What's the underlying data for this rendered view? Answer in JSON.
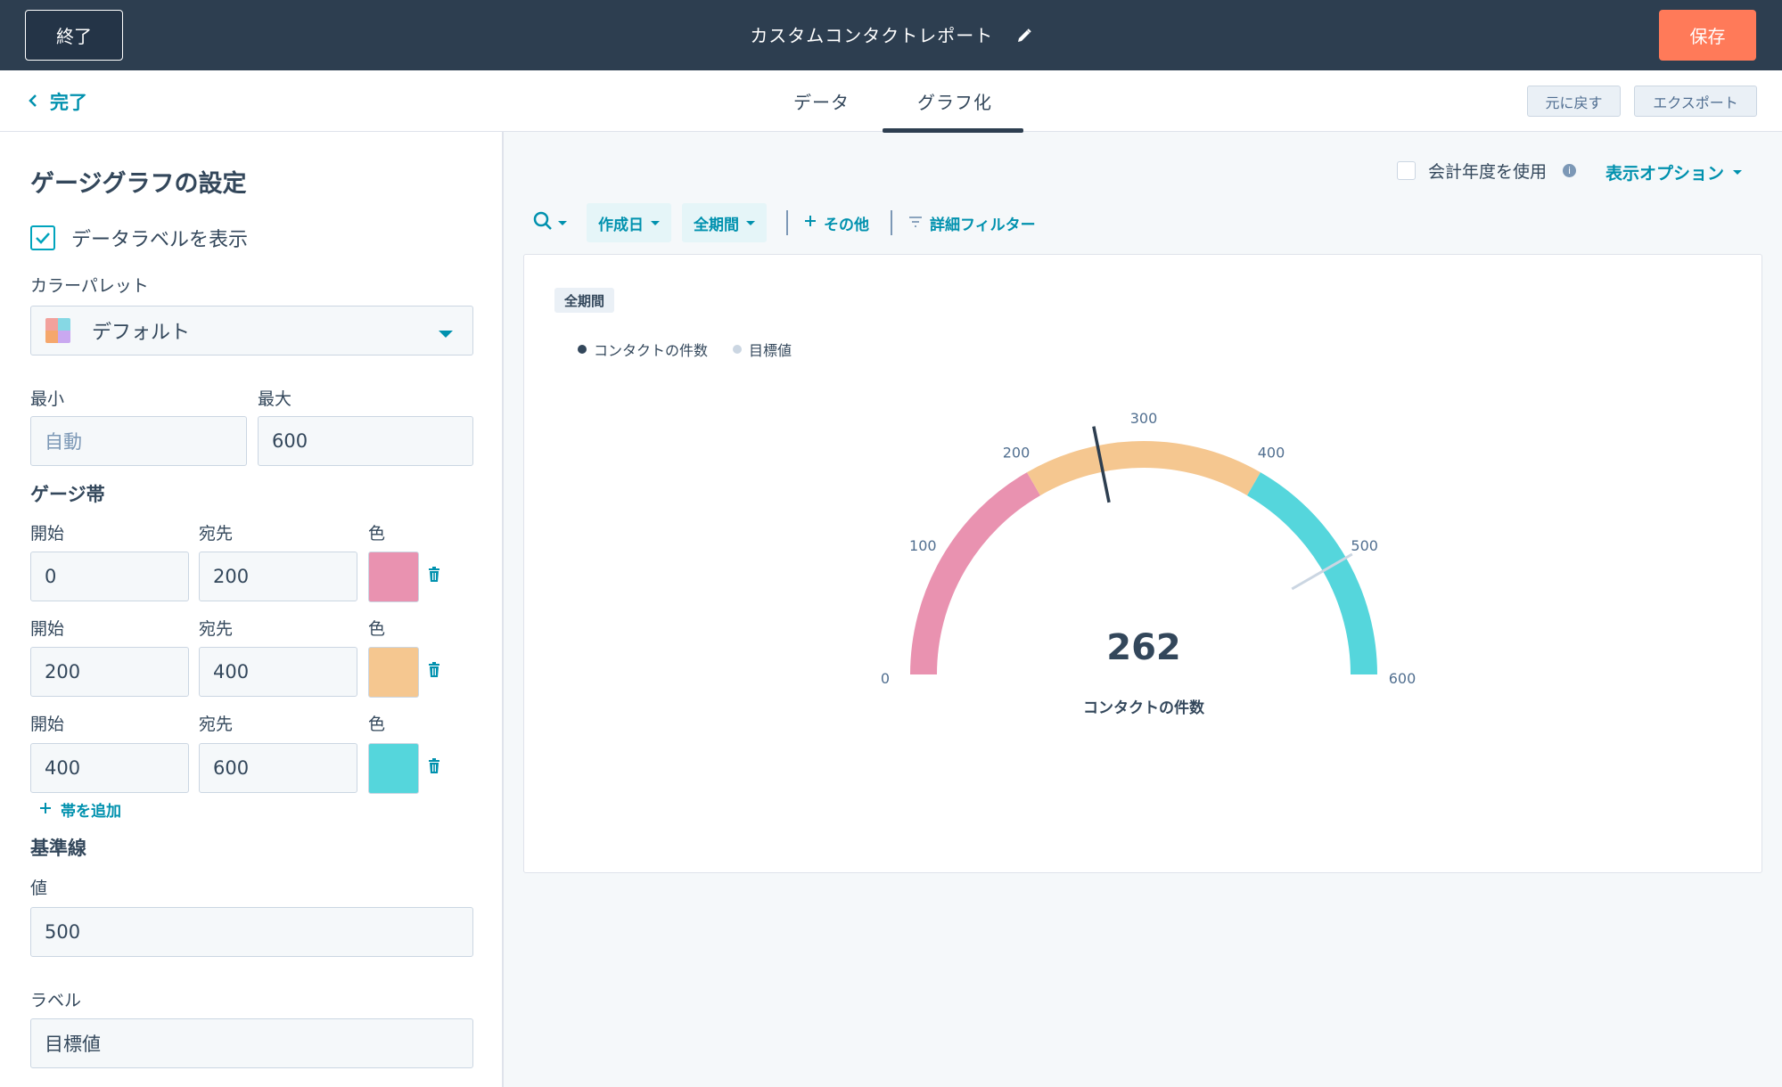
{
  "topbar": {
    "exit_label": "終了",
    "report_title": "カスタムコンタクトレポート",
    "save_label": "保存"
  },
  "subbar": {
    "back_label": "完了",
    "tabs": [
      {
        "label": "データ",
        "active": false
      },
      {
        "label": "グラフ化",
        "active": true
      }
    ],
    "undo_label": "元に戻す",
    "export_label": "エクスポート"
  },
  "settings": {
    "title": "ゲージグラフの設定",
    "show_data_labels": {
      "label": "データラベルを表示",
      "checked": true
    },
    "palette": {
      "label": "カラーパレット",
      "value": "デフォルト"
    },
    "min": {
      "label": "最小",
      "placeholder": "自動",
      "value": ""
    },
    "max": {
      "label": "最大",
      "value": "600"
    },
    "bands_heading": "ゲージ帯",
    "bands": [
      {
        "start_label": "開始",
        "end_label": "宛先",
        "color_label": "色",
        "start": "0",
        "end": "200",
        "color": "#e992b0"
      },
      {
        "start_label": "開始",
        "end_label": "宛先",
        "color_label": "色",
        "start": "200",
        "end": "400",
        "color": "#f5c790"
      },
      {
        "start_label": "開始",
        "end_label": "宛先",
        "color_label": "色",
        "start": "400",
        "end": "600",
        "color": "#55d6dc"
      }
    ],
    "add_band_label": "帯を追加",
    "baseline": {
      "heading": "基準線",
      "value_label": "値",
      "value": "500",
      "label_label": "ラベル",
      "label_value": "目標値"
    }
  },
  "toolbar": {
    "fiscal_year_label": "会計年度を使用",
    "fiscal_year_checked": false,
    "display_options_label": "表示オプション",
    "filters": [
      {
        "label": "作成日"
      },
      {
        "label": "全期間"
      }
    ],
    "more_label": "その他",
    "advanced_filter_label": "詳細フィルター"
  },
  "chart_data": {
    "type": "gauge",
    "period_tag": "全期間",
    "legend": [
      {
        "name": "コンタクトの件数",
        "color": "#33475b"
      },
      {
        "name": "目標値",
        "color": "#cbd6e2"
      }
    ],
    "min": 0,
    "max": 600,
    "ticks": [
      0,
      100,
      200,
      300,
      400,
      500,
      600
    ],
    "bands": [
      {
        "from": 0,
        "to": 200,
        "color": "#e992b0"
      },
      {
        "from": 200,
        "to": 400,
        "color": "#f5c790"
      },
      {
        "from": 400,
        "to": 600,
        "color": "#55d6dc"
      }
    ],
    "value": 262,
    "value_display": "262",
    "target": 500,
    "value_label": "コンタクトの件数"
  }
}
